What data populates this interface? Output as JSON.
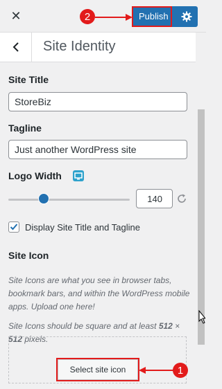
{
  "topbar": {
    "close_icon": "close-icon",
    "publish_label": "Publish",
    "settings_icon": "gear-icon"
  },
  "header": {
    "back_icon": "chevron-left-icon",
    "section_title": "Site Identity"
  },
  "fields": {
    "site_title_label": "Site Title",
    "site_title_value": "StoreBiz",
    "tagline_label": "Tagline",
    "tagline_value": "Just another WordPress site",
    "logo_width_label": "Logo Width",
    "logo_width_value": "140",
    "logo_width_fraction": 0.29,
    "display_title_label": "Display Site Title and Tagline",
    "display_title_checked": true
  },
  "site_icon": {
    "label": "Site Icon",
    "desc1": "Site Icons are what you see in browser tabs, bookmark bars, and within the WordPress mobile apps. Upload one here!",
    "desc2_part1": "Site Icons should be square and at least ",
    "desc2_bold1": "512",
    "desc2_mid": " × ",
    "desc2_bold2": "512",
    "desc2_part2": " pixels.",
    "select_label": "Select site icon"
  },
  "annotations": {
    "marker1": "1",
    "marker2": "2",
    "color": "#e21b1b"
  },
  "colors": {
    "accent": "#2271b1"
  }
}
